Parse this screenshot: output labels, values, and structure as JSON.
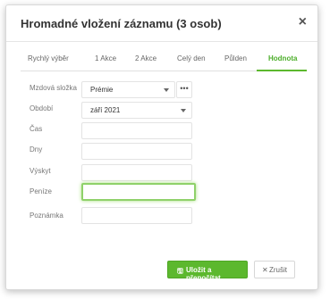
{
  "dialog": {
    "title": "Hromadné vložení záznamu (3 osob)",
    "close_icon": "×"
  },
  "tabs": [
    {
      "label": "Rychlý výběr"
    },
    {
      "label": "1 Akce"
    },
    {
      "label": "2 Akce"
    },
    {
      "label": "Celý den"
    },
    {
      "label": "Půlden"
    },
    {
      "label": "Hodnota"
    }
  ],
  "active_tab": "Hodnota",
  "form": {
    "mzdova_slozka": {
      "label": "Mzdová složka",
      "value": "Prémie",
      "more": "•••"
    },
    "obdobi": {
      "label": "Období",
      "value": "září 2021"
    },
    "cas": {
      "label": "Čas",
      "value": ""
    },
    "dny": {
      "label": "Dny",
      "value": ""
    },
    "vyskyt": {
      "label": "Výskyt",
      "value": ""
    },
    "penize": {
      "label": "Peníze",
      "value": ""
    },
    "poznamka": {
      "label": "Poznámka",
      "value": ""
    }
  },
  "footer": {
    "save_label": "Uložit a přepočítat",
    "save_icon": "save-icon",
    "cancel_label": "Zrušit",
    "cancel_icon": "close-icon"
  },
  "colors": {
    "accent": "#5cb82e",
    "focus_glow": "#a8e07f"
  }
}
